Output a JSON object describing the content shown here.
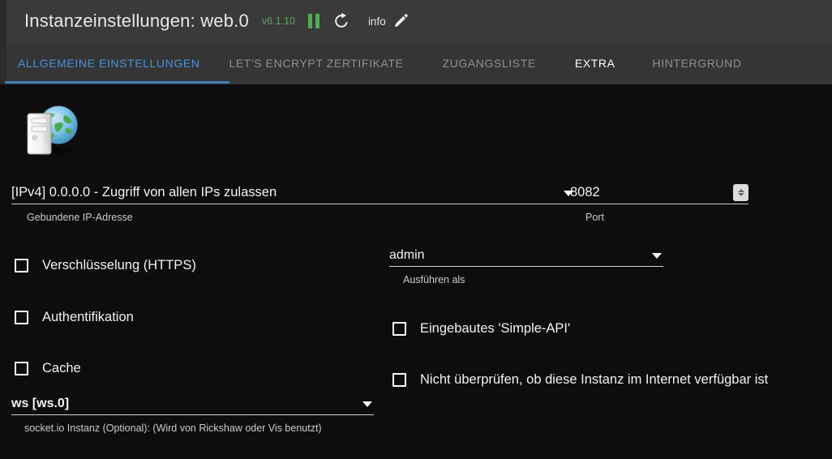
{
  "header": {
    "title": "Instanzeinstellungen: web.0",
    "version": "v6.1.10",
    "pause_icon": "pause-icon",
    "refresh_icon": "refresh-icon",
    "info_label": "info",
    "edit_icon": "pencil-edit-icon",
    "accent_green": "#4caf50",
    "background": "#3a3a3a"
  },
  "tabs": {
    "active_index": 0,
    "underline_color": "#3f7fb8",
    "items": [
      {
        "label": "ALLGEMEINE EINSTELLUNGEN",
        "state": "active"
      },
      {
        "label": "LET'S ENCRYPT ZERTIFIKATE",
        "state": "inactive"
      },
      {
        "label": "ZUGANGSLISTE",
        "state": "inactive"
      },
      {
        "label": "EXTRA",
        "state": "hover"
      },
      {
        "label": "HINTERGRUND",
        "state": "inactive"
      }
    ]
  },
  "content": {
    "adapter_icon": "web-server-globe-icon",
    "bound_ip": {
      "value": "[IPv4] 0.0.0.0 - Zugriff von allen IPs zulassen",
      "helper": "Gebundene IP-Adresse",
      "icon": "chevron-down-icon"
    },
    "port": {
      "value": "8082",
      "helper": "Port",
      "icon": "number-spinner-icon"
    },
    "run_as": {
      "value": "admin",
      "helper": "Ausführen als",
      "icon": "chevron-down-icon"
    },
    "socket_io": {
      "value": "ws [ws.0]",
      "helper": "socket.io Instanz (Optional): (Wird von Rickshaw oder Vis benutzt)",
      "icon": "chevron-down-icon"
    },
    "checkboxes": [
      {
        "label": "Verschlüsselung (HTTPS)",
        "checked": false
      },
      {
        "label": "Authentifikation",
        "checked": false
      },
      {
        "label": "Cache",
        "checked": false
      },
      {
        "label": "Eingebautes 'Simple-API'",
        "checked": false
      },
      {
        "label": "Nicht überprüfen, ob diese Instanz im Internet verfügbar ist",
        "checked": false
      }
    ]
  }
}
